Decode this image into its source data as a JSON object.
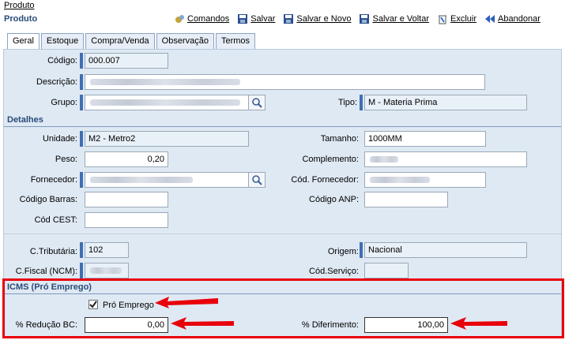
{
  "breadcrumb": "Produto",
  "page_title": "Produto",
  "toolbar": {
    "comandos": "Comandos",
    "salvar": "Salvar",
    "salvar_novo": "Salvar e Novo",
    "salvar_voltar": "Salvar e Voltar",
    "excluir": "Excluir",
    "abandonar": "Abandonar"
  },
  "tabs": [
    "Geral",
    "Estoque",
    "Compra/Venda",
    "Observação",
    "Termos"
  ],
  "fields": {
    "codigo_label": "Código:",
    "codigo_value": "000.007",
    "descricao_label": "Descrição:",
    "grupo_label": "Grupo:",
    "tipo_label": "Tipo:",
    "tipo_value": "M - Materia Prima"
  },
  "detalhes": {
    "title": "Detalhes",
    "unidade_label": "Unidade:",
    "unidade_value": "M2 - Metro2",
    "tamanho_label": "Tamanho:",
    "tamanho_value": "1000MM",
    "peso_label": "Peso:",
    "peso_value": "0,20",
    "complemento_label": "Complemento:",
    "fornecedor_label": "Fornecedor:",
    "cod_fornecedor_label": "Cód. Fornecedor:",
    "codigo_barras_label": "Código Barras:",
    "codigo_anp_label": "Código ANP:",
    "cod_cest_label": "Cód CEST:",
    "c_tributaria_label": "C.Tributária:",
    "c_tributaria_value": "102",
    "origem_label": "Origem:",
    "origem_value": "Nacional",
    "c_fiscal_label": "C.Fiscal (NCM):",
    "cod_servico_label": "Cód.Serviço:"
  },
  "icms": {
    "title": "ICMS (Pró Emprego)",
    "pro_emprego_label": "Pró Emprego",
    "pro_emprego_checked": true,
    "reducao_label": "% Redução BC:",
    "reducao_value": "0,00",
    "diferimento_label": "% Diferimento:",
    "diferimento_value": "100,00"
  },
  "colors": {
    "accent": "#3f6fb3",
    "panel": "#dfe9f3",
    "highlight": "#e8000b"
  }
}
